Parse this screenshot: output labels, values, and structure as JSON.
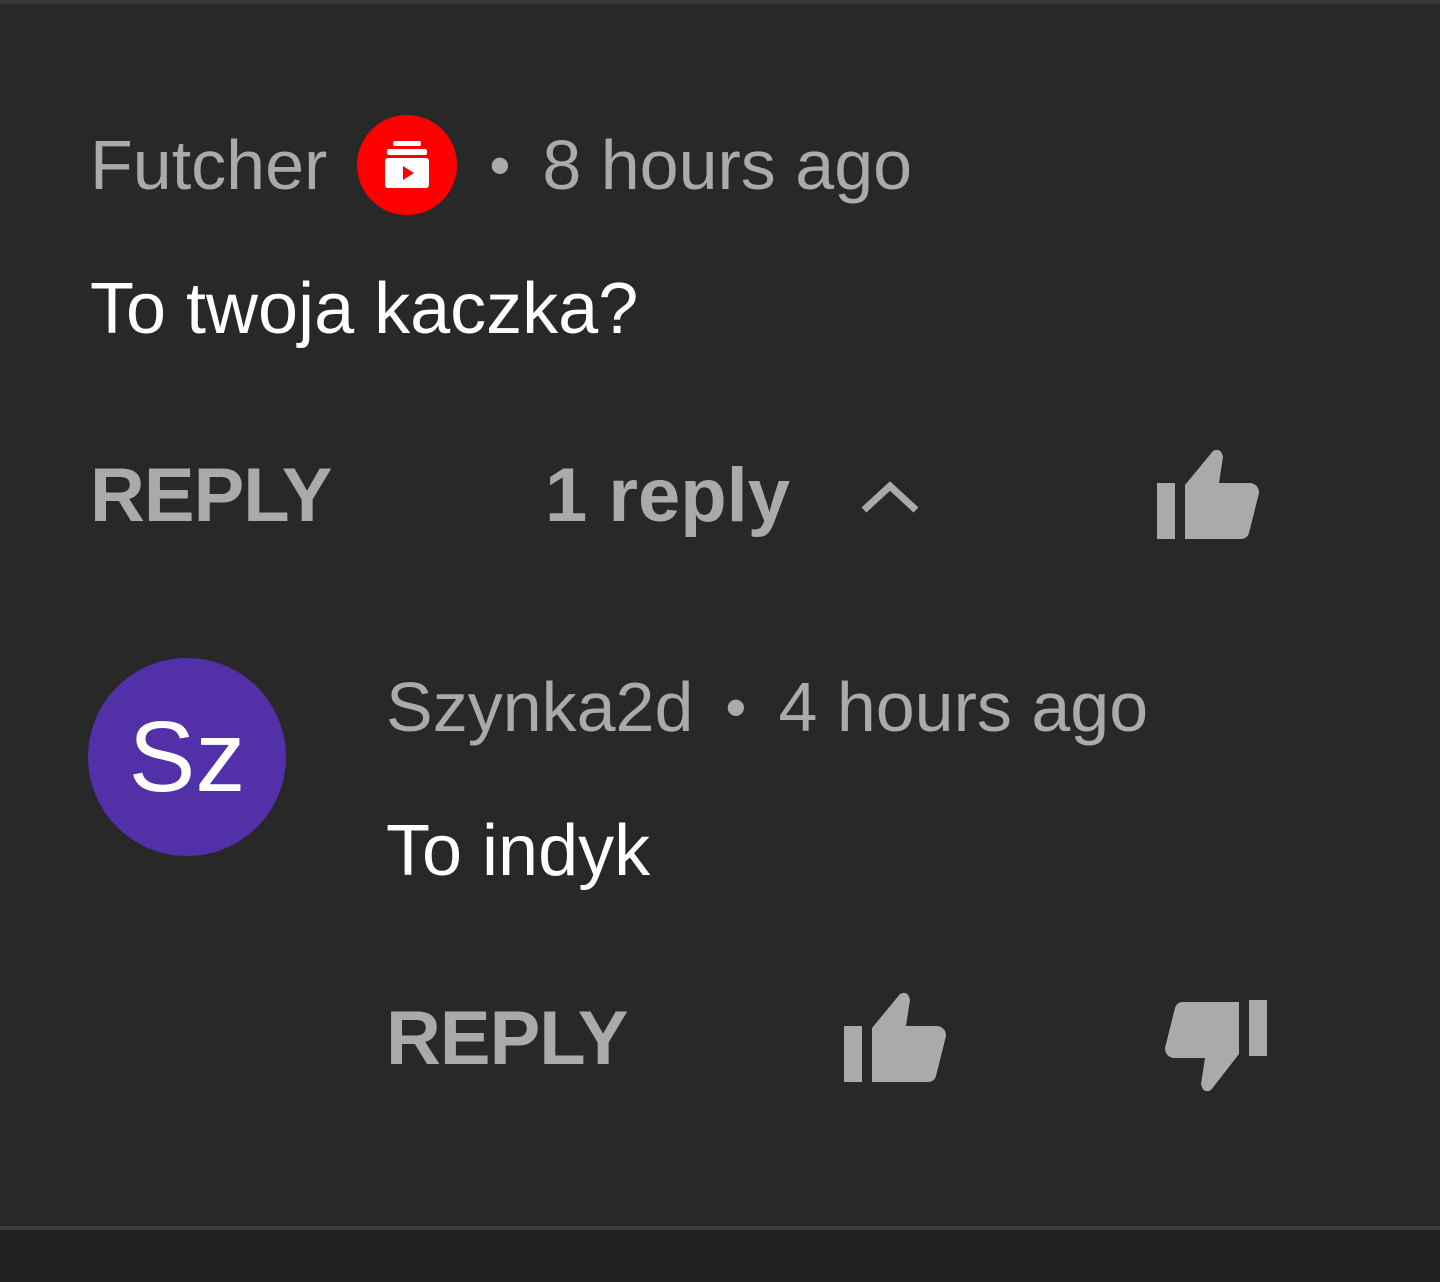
{
  "parent_comment": {
    "author": "Futcher",
    "badge_icon": "creator-badge-icon",
    "badge_color": "#ff0000",
    "separator": "•",
    "timestamp": "8 hours ago",
    "text": "To twoja kaczka?",
    "reply_label": "REPLY",
    "replies_toggle": "1 reply"
  },
  "reply_comment": {
    "avatar_initials": "Sz",
    "avatar_color": "#5130a8",
    "author": "Szynka2d",
    "separator": "•",
    "timestamp": "4 hours ago",
    "text": "To indyk",
    "reply_label": "REPLY"
  },
  "colors": {
    "background": "#282828",
    "primary_text": "#ffffff",
    "secondary_text": "#aaaaaa"
  }
}
